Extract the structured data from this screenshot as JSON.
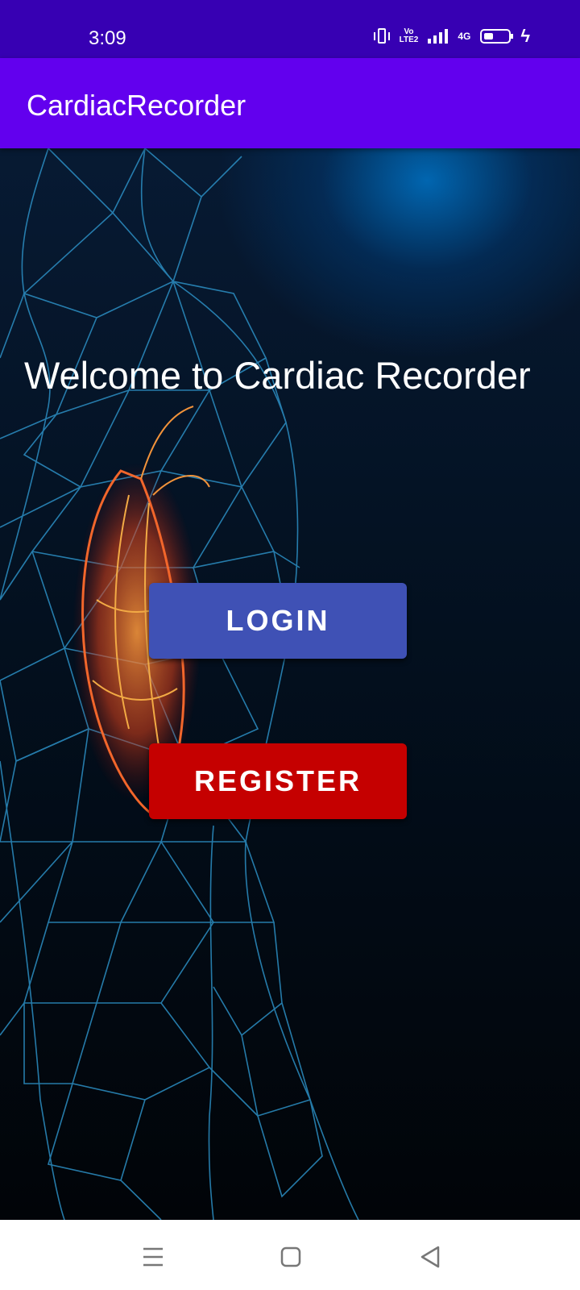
{
  "status_bar": {
    "time": "3:09",
    "lte_top": "Vo",
    "lte_bottom": "LTE2",
    "network": "4G",
    "battery_percent": 40,
    "icons": [
      "vibrate-icon",
      "volte-icon",
      "signal-icon",
      "4g-signal-icon",
      "battery-icon",
      "charging-icon"
    ]
  },
  "app_bar": {
    "title": "CardiacRecorder"
  },
  "main": {
    "welcome_text": "Welcome to Cardiac Recorder",
    "login_label": "LOGIN",
    "register_label": "REGISTER",
    "background_image": "wireframe-human-body-with-heart"
  },
  "nav_bar": {
    "icons": [
      "menu-icon",
      "home-icon",
      "back-icon"
    ]
  },
  "colors": {
    "status_bar": "#3700B3",
    "app_bar": "#6200EE",
    "login_button": "#3F51B5",
    "register_button": "#C50000",
    "nav_bar": "#FFFFFF"
  }
}
